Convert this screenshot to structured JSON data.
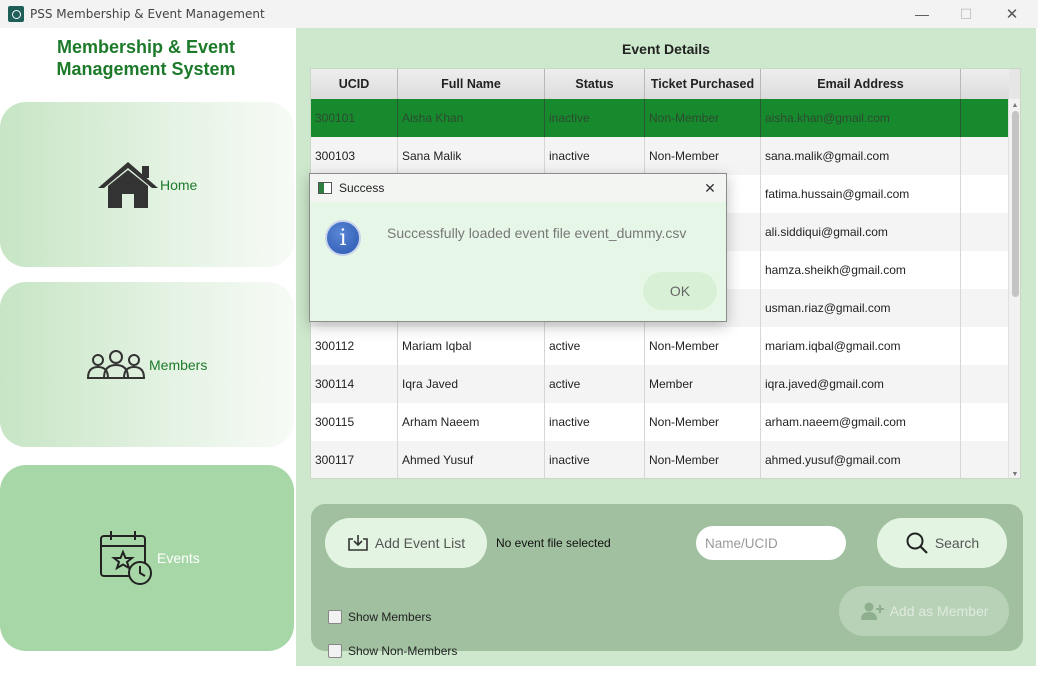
{
  "window": {
    "title": "PSS Membership & Event Management",
    "minimize": "—",
    "maximize": "☐",
    "close": "✕"
  },
  "sidebar": {
    "heading_line1": "Membership & Event",
    "heading_line2": "Management System",
    "items": [
      {
        "label": "Home",
        "icon": "home-icon"
      },
      {
        "label": "Members",
        "icon": "members-icon"
      },
      {
        "label": "Events",
        "icon": "calendar-icon"
      }
    ]
  },
  "main": {
    "title": "Event Details",
    "table": {
      "columns": [
        "UCID",
        "Full Name",
        "Status",
        "Ticket Purchased",
        "Email Address"
      ],
      "rows": [
        [
          "300101",
          "Aisha Khan",
          "inactive",
          "Non-Member",
          "aisha.khan@gmail.com"
        ],
        [
          "300103",
          "Sana Malik",
          "inactive",
          "Non-Member",
          "sana.malik@gmail.com"
        ],
        [
          "",
          "",
          "",
          "",
          "fatima.hussain@gmail.com"
        ],
        [
          "",
          "",
          "",
          "",
          "ali.siddiqui@gmail.com"
        ],
        [
          "",
          "",
          "",
          "",
          "hamza.sheikh@gmail.com"
        ],
        [
          "",
          "",
          "",
          "",
          "usman.riaz@gmail.com"
        ],
        [
          "300112",
          "Mariam Iqbal",
          "active",
          "Non-Member",
          "mariam.iqbal@gmail.com"
        ],
        [
          "300114",
          "Iqra Javed",
          "active",
          "Member",
          "iqra.javed@gmail.com"
        ],
        [
          "300115",
          "Arham Naeem",
          "inactive",
          "Non-Member",
          "arham.naeem@gmail.com"
        ],
        [
          "300117",
          "Ahmed Yusuf",
          "inactive",
          "Non-Member",
          "ahmed.yusuf@gmail.com"
        ]
      ]
    },
    "controls": {
      "add_event_list": "Add Event List",
      "file_status": "No event file selected",
      "search_placeholder": "Name/UCID",
      "search_label": "Search",
      "show_members": "Show Members",
      "show_non_members": "Show Non-Members",
      "add_as_member": "Add as Member"
    }
  },
  "dialog": {
    "title": "Success",
    "message": "Successfully loaded event file event_dummy.csv",
    "ok": "OK",
    "info_glyph": "i",
    "close": "✕"
  },
  "colors": {
    "accent_green": "#1d7a2a",
    "selected_row": "#188a2e",
    "panel_bg": "#cde8cc",
    "controls_bg": "#a0c09f"
  }
}
